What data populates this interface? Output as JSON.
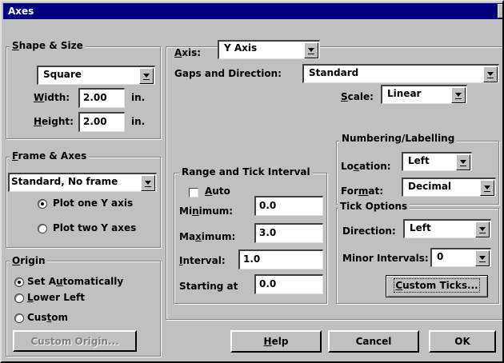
{
  "window": {
    "title": "Axes",
    "close_glyph": "✕"
  },
  "shape_size": {
    "title_u": "S",
    "title_rest": "hape & Size",
    "shape_value": "Square",
    "width_u": "W",
    "width_rest": "idth:",
    "width_value": "2.00",
    "width_unit": "in.",
    "height_u": "H",
    "height_rest": "eight:",
    "height_value": "2.00",
    "height_unit": "in."
  },
  "frame_axes": {
    "title_u": "F",
    "title_rest": "rame & Axes",
    "frame_value": "Standard, No frame",
    "plot_one": "Plot one Y axis",
    "plot_two": "Plot two Y axes"
  },
  "origin": {
    "title_u": "O",
    "title_rest": "rigin",
    "set_pre": "Set A",
    "set_u": "u",
    "set_post": "tomatically",
    "lower_u": "L",
    "lower_rest": "ower Left",
    "custom_pre": "Cus",
    "custom_u": "t",
    "custom_post": "om",
    "custom_origin_pre": "C",
    "custom_origin_u": "",
    "custom_origin": "Custom Origin..."
  },
  "axis": {
    "label_u": "A",
    "label_rest": "xis:",
    "value": "Y Axis",
    "gaps_label": "Gaps and Direction:",
    "gaps_value": "Standard",
    "scale_u": "S",
    "scale_rest": "cale:",
    "scale_value": "Linear"
  },
  "range": {
    "title": "Range and Tick Interval",
    "auto_u": "A",
    "auto_rest": "uto",
    "min_pre": "Mi",
    "min_u": "n",
    "min_post": "imum:",
    "min_value": "0.0",
    "max_pre": "Ma",
    "max_u": "x",
    "max_post": "imum:",
    "max_value": "3.0",
    "interval_u": "I",
    "interval_rest": "nterval:",
    "interval_value": "1.0",
    "start_label": "Starting at",
    "start_value": "0.0"
  },
  "numbering": {
    "title": "Numbering/Labelling",
    "loc_pre": "Lo",
    "loc_u": "c",
    "loc_post": "ation:",
    "loc_value": "Left",
    "fmt_pre": "For",
    "fmt_u": "m",
    "fmt_post": "at:",
    "fmt_value": "Decimal"
  },
  "tick_options": {
    "title": "Tick Options",
    "direction_label": "Direction:",
    "direction_value": "Left",
    "minor_label": "Minor Intervals:",
    "minor_value": "0",
    "custom_u": "C",
    "custom_rest": "ustom Ticks..."
  },
  "buttons": {
    "help_u": "H",
    "help_rest": "elp",
    "cancel": "Cancel",
    "ok": "OK"
  }
}
